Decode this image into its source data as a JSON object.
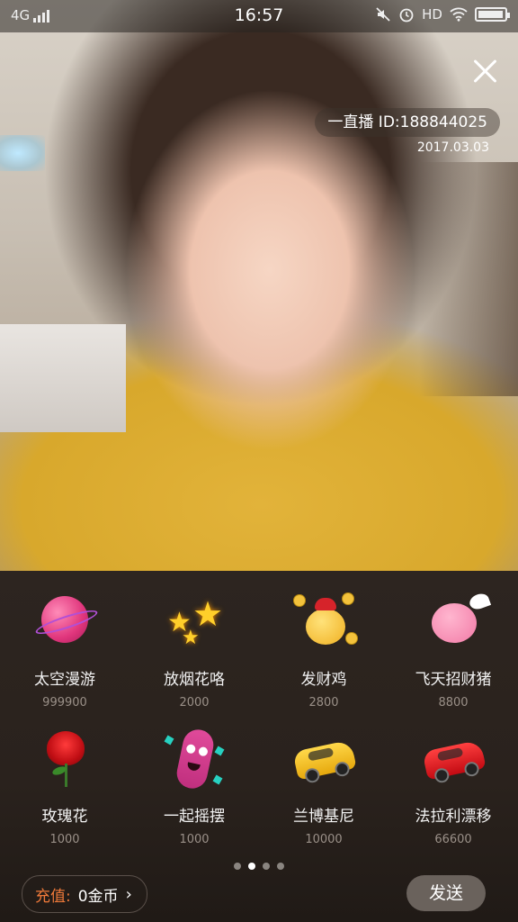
{
  "status_bar": {
    "network": "4G",
    "time": "16:57",
    "hd": "HD",
    "battery_level": 0.95
  },
  "live": {
    "id_label": "一直播 ID:188844025",
    "date": "2017.03.03"
  },
  "gifts": [
    {
      "name": "太空漫游",
      "price": "999900",
      "icon": "space-ball-icon"
    },
    {
      "name": "放烟花咯",
      "price": "2000",
      "icon": "fireworks-icon"
    },
    {
      "name": "发财鸡",
      "price": "2800",
      "icon": "lucky-chick-icon"
    },
    {
      "name": "飞天招财猪",
      "price": "8800",
      "icon": "flying-pig-icon"
    },
    {
      "name": "玫瑰花",
      "price": "1000",
      "icon": "rose-icon"
    },
    {
      "name": "一起摇摆",
      "price": "1000",
      "icon": "dancing-sausage-icon"
    },
    {
      "name": "兰博基尼",
      "price": "10000",
      "icon": "lamborghini-icon"
    },
    {
      "name": "法拉利漂移",
      "price": "66600",
      "icon": "ferrari-icon"
    }
  ],
  "pagination": {
    "pages": 4,
    "active": 1
  },
  "footer": {
    "recharge_label": "充值:",
    "balance": "0金币",
    "send_label": "发送"
  },
  "colors": {
    "recharge_accent": "#f07a3a",
    "panel_bg": "#2a221d",
    "send_button": "#6a625c"
  }
}
